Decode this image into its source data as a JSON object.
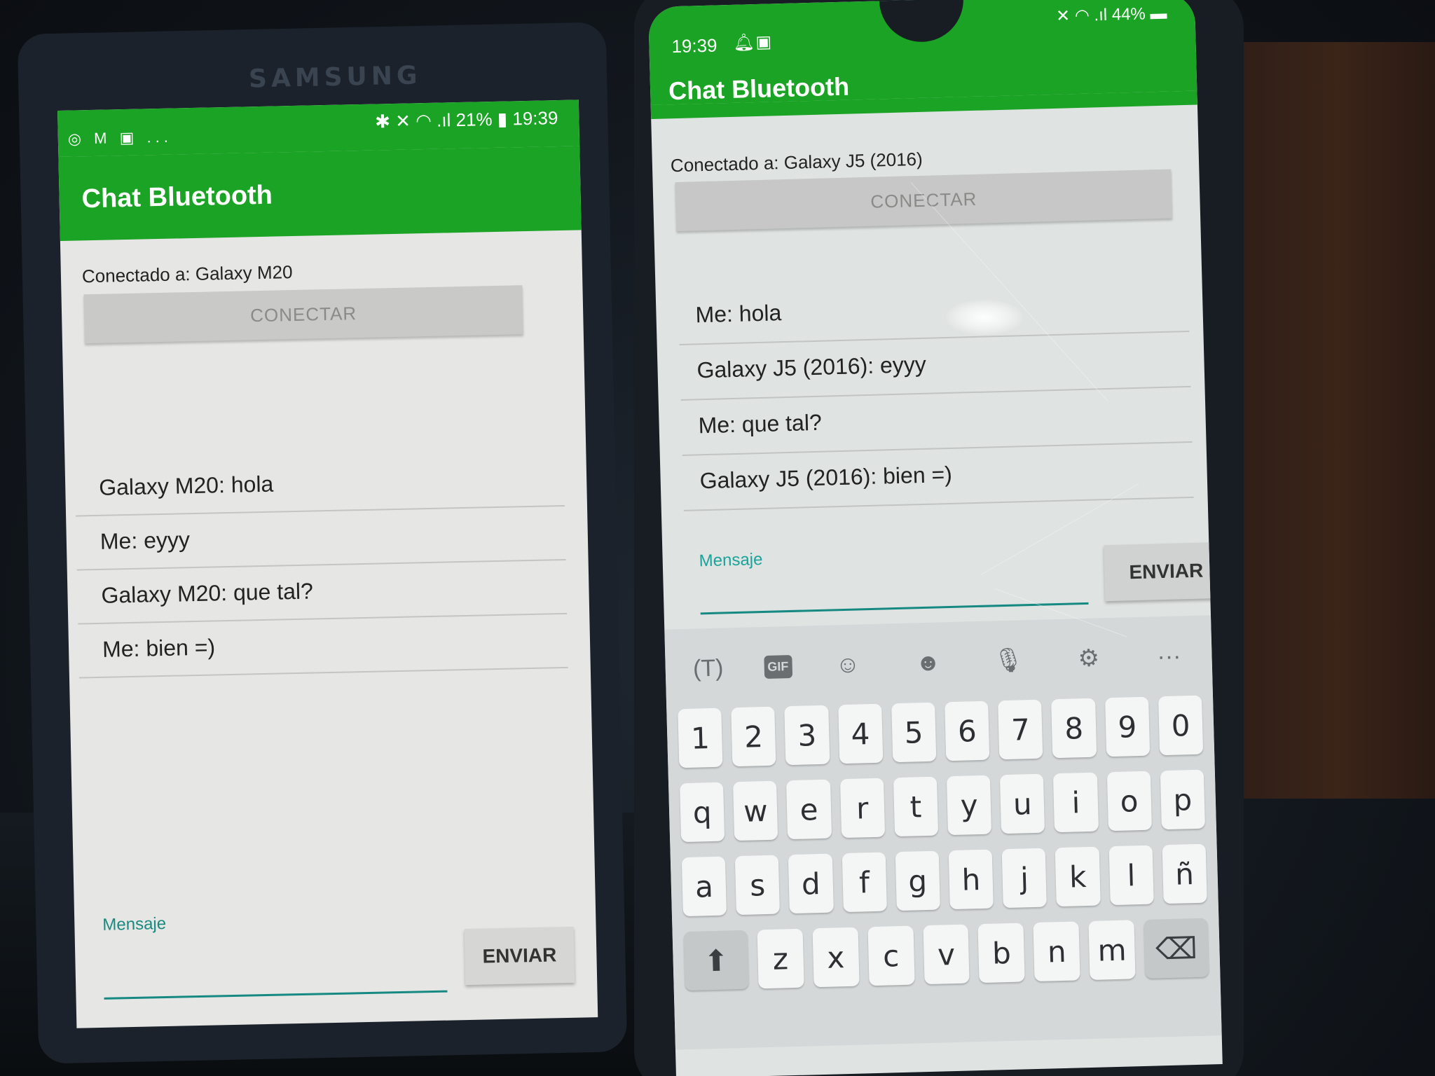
{
  "phone_left": {
    "brand": "SAMSUNG",
    "status": {
      "left_icons": "◎ M ▣ ...",
      "right_info": "✱ ✕ ◠ .ıl 21% ▮ 19:39"
    },
    "app_title": "Chat Bluetooth",
    "connected_label": "Conectado a: Galaxy M20",
    "connect_button": "CONECTAR",
    "messages": [
      "Galaxy M20:  hola",
      "Me: eyyy",
      "Galaxy M20:  que tal?",
      "Me: bien =)"
    ],
    "input_label": "Mensaje",
    "input_value": "",
    "send_button": "ENVIAR"
  },
  "phone_right": {
    "status": {
      "time": "19:39",
      "bell_icon": "bell-icon",
      "image_icon": "image-icon",
      "right_info": "✕ ◠ .ıl 44% ▬"
    },
    "app_title": "Chat Bluetooth",
    "connected_label": "Conectado a: Galaxy J5 (2016)",
    "connect_button": "CONECTAR",
    "messages": [
      "Me: hola",
      "Galaxy J5 (2016):  eyyy",
      "Me: que tal?",
      "Galaxy J5 (2016):  bien =)"
    ],
    "input_label": "Mensaje",
    "input_value": "",
    "send_button": "ENVIAR",
    "keyboard": {
      "toolbar": [
        "(T)",
        "GIF",
        "☺",
        "☻",
        "🎙",
        "⚙",
        "···"
      ],
      "row_numbers": [
        "1",
        "2",
        "3",
        "4",
        "5",
        "6",
        "7",
        "8",
        "9",
        "0"
      ],
      "row_q": [
        "q",
        "w",
        "e",
        "r",
        "t",
        "y",
        "u",
        "i",
        "o",
        "p"
      ],
      "row_a": [
        "a",
        "s",
        "d",
        "f",
        "g",
        "h",
        "j",
        "k",
        "l",
        "ñ"
      ],
      "row_z": [
        "⬆",
        "z",
        "x",
        "c",
        "v",
        "b",
        "n",
        "m",
        "⌫"
      ]
    }
  },
  "colors": {
    "app_green": "#1aa324",
    "accent_teal": "#168a82"
  }
}
